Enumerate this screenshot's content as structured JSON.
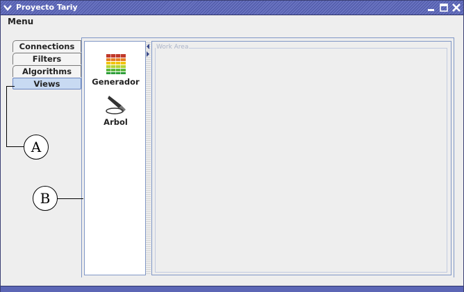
{
  "window": {
    "title": "Proyecto Tariy",
    "window_menu_icon": "chevron-down-icon",
    "minimize_icon": "minimize-icon",
    "maximize_icon": "maximize-icon",
    "close_icon": "close-icon"
  },
  "menubar": {
    "items": [
      "Menu"
    ]
  },
  "tabs": [
    {
      "label": "Connections",
      "active": false
    },
    {
      "label": "Filters",
      "active": false
    },
    {
      "label": "Algorithms",
      "active": false
    },
    {
      "label": "Views",
      "active": true
    }
  ],
  "views_list": [
    {
      "label": "Generador",
      "icon": "equalizer-bars-icon"
    },
    {
      "label": "Arbol",
      "icon": "fountain-pen-icon"
    }
  ],
  "work_area": {
    "label": "Work Area"
  },
  "callouts": [
    {
      "label": "A"
    },
    {
      "label": "B"
    }
  ],
  "colors": {
    "titlebar": "#5c66b5",
    "active_tab": "#c8daf2",
    "panel_border": "#7f96c5"
  }
}
